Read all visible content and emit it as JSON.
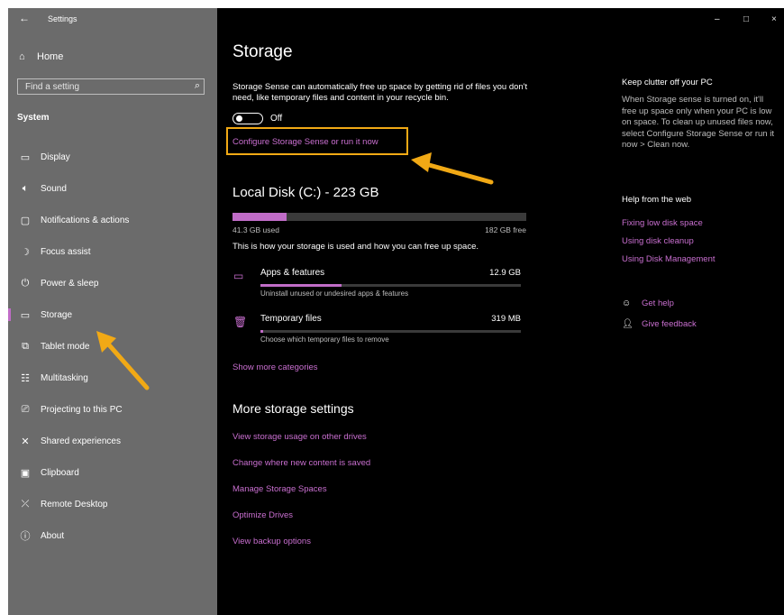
{
  "app": {
    "title": "Settings",
    "back_icon": "back-arrow-icon"
  },
  "window_controls": {
    "minimize": "–",
    "maximize": "□",
    "close": "×"
  },
  "sidebar": {
    "home": "Home",
    "search_placeholder": "Find a setting",
    "section": "System",
    "items": [
      {
        "label": "Display",
        "icon": "display-icon",
        "glyph": "▭",
        "selected": false
      },
      {
        "label": "Sound",
        "icon": "sound-icon",
        "glyph": "🔈︎",
        "selected": false
      },
      {
        "label": "Notifications & actions",
        "icon": "notifications-icon",
        "glyph": "▢",
        "selected": false
      },
      {
        "label": "Focus assist",
        "icon": "moon-icon",
        "glyph": "☽",
        "selected": false
      },
      {
        "label": "Power & sleep",
        "icon": "power-icon",
        "glyph": "⏻",
        "selected": false
      },
      {
        "label": "Storage",
        "icon": "storage-icon",
        "glyph": "▭",
        "selected": true
      },
      {
        "label": "Tablet mode",
        "icon": "tablet-icon",
        "glyph": "⧉",
        "selected": false
      },
      {
        "label": "Multitasking",
        "icon": "multitasking-icon",
        "glyph": "☷",
        "selected": false
      },
      {
        "label": "Projecting to this PC",
        "icon": "projecting-icon",
        "glyph": "⎚",
        "selected": false
      },
      {
        "label": "Shared experiences",
        "icon": "shared-icon",
        "glyph": "✕",
        "selected": false
      },
      {
        "label": "Clipboard",
        "icon": "clipboard-icon",
        "glyph": "▣",
        "selected": false
      },
      {
        "label": "Remote Desktop",
        "icon": "remote-desktop-icon",
        "glyph": "⤫",
        "selected": false
      },
      {
        "label": "About",
        "icon": "info-icon",
        "glyph": "ⓘ",
        "selected": false
      }
    ]
  },
  "main": {
    "title": "Storage",
    "description": "Storage Sense can automatically free up space by getting rid of files you don't need, like temporary files and content in your recycle bin.",
    "toggle_label": "Off",
    "toggle_on": false,
    "configure_link": "Configure Storage Sense or run it now",
    "disk": {
      "title": "Local Disk (C:) - 223 GB",
      "used_label": "41.3 GB used",
      "free_label": "182 GB free",
      "used_fraction": 0.185
    },
    "usage_text": "This is how your storage is used and how you can free up space.",
    "categories": [
      {
        "name": "Apps & features",
        "size": "12.9 GB",
        "sub": "Uninstall unused or undesired apps & features",
        "fraction": 0.31,
        "icon": "apps-icon",
        "glyph": "▭"
      },
      {
        "name": "Temporary files",
        "size": "319 MB",
        "sub": "Choose which temporary files to remove",
        "fraction": 0.01,
        "icon": "trash-icon",
        "glyph": "🗑︎"
      }
    ],
    "show_more": "Show more categories",
    "more_title": "More storage settings",
    "more_links": [
      "View storage usage on other drives",
      "Change where new content is saved",
      "Manage Storage Spaces",
      "Optimize Drives",
      "View backup options"
    ]
  },
  "right": {
    "clutter_title": "Keep clutter off your PC",
    "clutter_text": "When Storage sense is turned on, it'll free up space only when your PC is low on space. To clean up unused files now, select Configure Storage Sense or run it now > Clean now.",
    "help_title": "Help from the web",
    "help_links": [
      "Fixing low disk space",
      "Using disk cleanup",
      "Using Disk Management"
    ],
    "get_help": "Get help",
    "give_feedback": "Give feedback"
  },
  "colors": {
    "accent": "#c96fd0",
    "highlight": "#f1a915",
    "sidebar_bg": "#6b6b6b",
    "main_bg": "#000000"
  }
}
